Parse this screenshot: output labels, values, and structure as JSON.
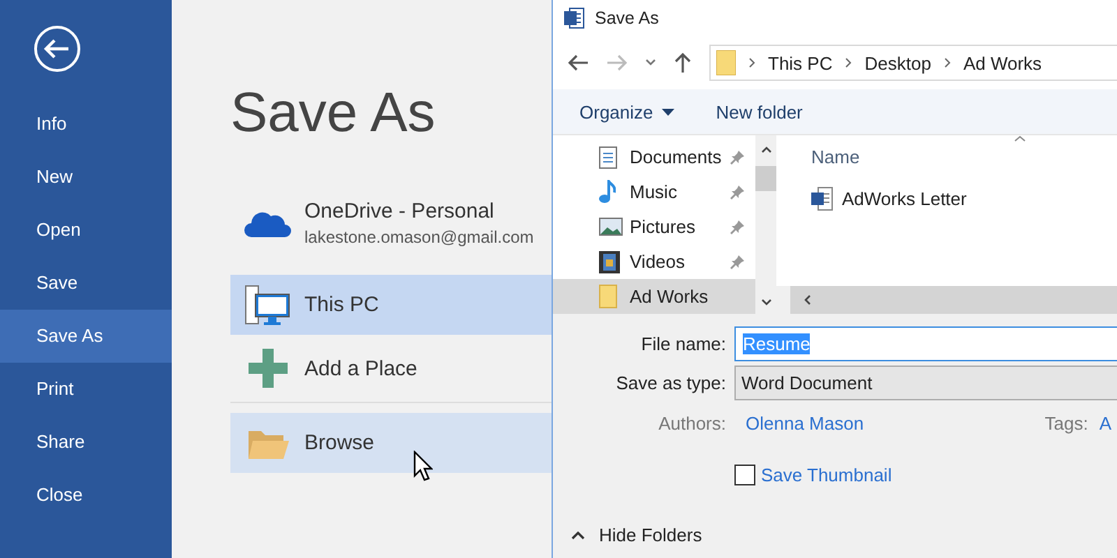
{
  "sidebar": {
    "items": [
      {
        "label": "Info",
        "selected": false
      },
      {
        "label": "New",
        "selected": false
      },
      {
        "label": "Open",
        "selected": false
      },
      {
        "label": "Save",
        "selected": false
      },
      {
        "label": "Save As",
        "selected": true
      },
      {
        "label": "Print",
        "selected": false
      },
      {
        "label": "Share",
        "selected": false
      },
      {
        "label": "Close",
        "selected": false
      }
    ]
  },
  "page_title": "Save As",
  "places": [
    {
      "kind": "onedrive",
      "label": "OneDrive - Personal",
      "detail": "lakestone.omason@gmail.com",
      "selected": false,
      "hovered": false
    },
    {
      "kind": "pc",
      "label": "This PC",
      "selected": true,
      "hovered": false
    },
    {
      "kind": "add",
      "label": "Add a Place",
      "selected": false,
      "hovered": false
    },
    {
      "kind": "browse",
      "label": "Browse",
      "selected": false,
      "hovered": true
    }
  ],
  "dialog": {
    "title": "Save As",
    "breadcrumb": [
      "This PC",
      "Desktop",
      "Ad Works"
    ],
    "toolbar": [
      {
        "label": "Organize",
        "dropdown": true
      },
      {
        "label": "New folder",
        "dropdown": false
      }
    ],
    "nav_items": [
      {
        "kind": "documents",
        "label": "Documents",
        "pinned": true,
        "selected": false
      },
      {
        "kind": "music",
        "label": "Music",
        "pinned": true,
        "selected": false
      },
      {
        "kind": "pictures",
        "label": "Pictures",
        "pinned": true,
        "selected": false
      },
      {
        "kind": "videos",
        "label": "Videos",
        "pinned": true,
        "selected": false
      },
      {
        "kind": "folder",
        "label": "Ad Works",
        "pinned": false,
        "selected": true
      }
    ],
    "column_header": "Name",
    "files": [
      {
        "name": "AdWorks Letter"
      }
    ],
    "file_name_label": "File name:",
    "file_name": "Resume",
    "type_label": "Save as type:",
    "type": "Word Document",
    "authors_label": "Authors:",
    "authors": "Olenna Mason",
    "tags_label": "Tags:",
    "tags": "A",
    "thumbnail": {
      "label": "Save Thumbnail",
      "checked": false
    },
    "hide_folders": "Hide Folders"
  }
}
